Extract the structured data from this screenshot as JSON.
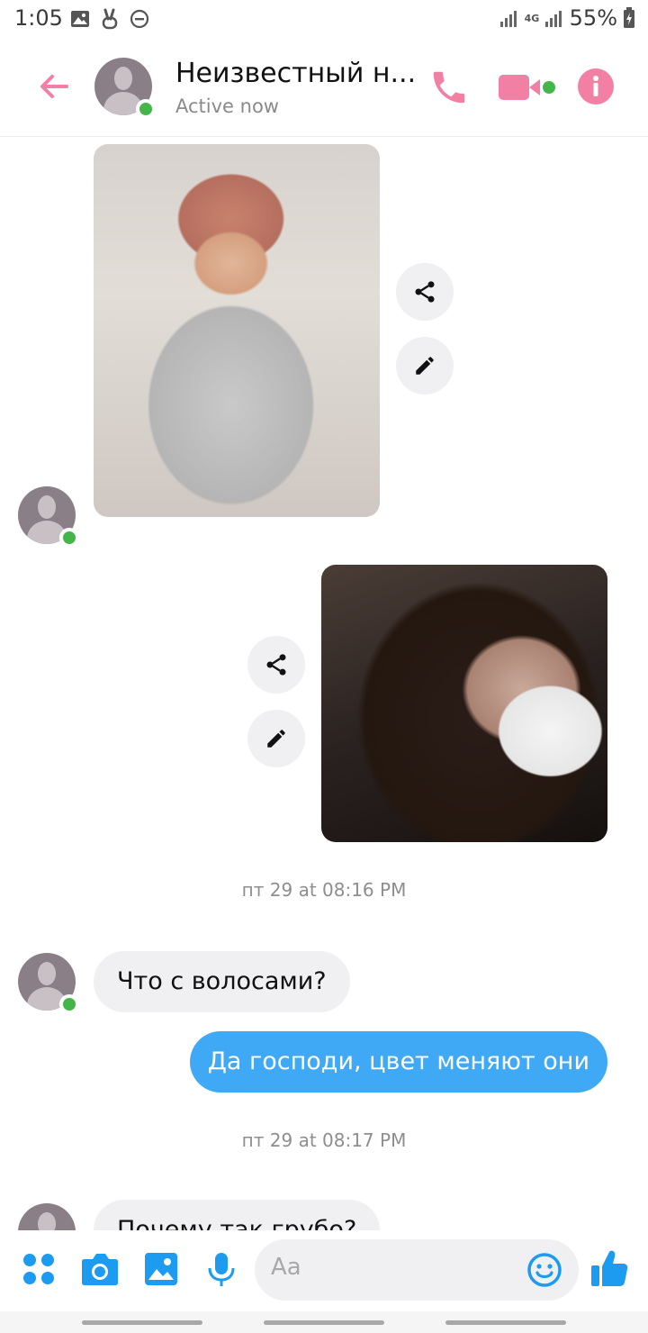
{
  "status_bar": {
    "time": "1:05",
    "network": "4G",
    "battery": "55%"
  },
  "header": {
    "title": "Неизвестный н...",
    "subtitle": "Active now"
  },
  "messages": {
    "timestamp1": "пт 29 at 08:16 PM",
    "incoming1": "Что с волосами?",
    "outgoing1": "Да господи, цвет меняют они",
    "timestamp2": "пт 29 at 08:17 PM",
    "incoming2": "Почему так грубо?"
  },
  "composer": {
    "placeholder": "Aa"
  },
  "colors": {
    "accent_pink": "#f27fa4",
    "accent_blue": "#1d9bf0",
    "online": "#44b549",
    "outgoing_bubble": "#3fa9f5"
  },
  "icons": [
    "back-arrow-icon",
    "phone-icon",
    "video-camera-icon",
    "info-icon",
    "share-icon",
    "edit-pencil-icon",
    "apps-icon",
    "camera-icon",
    "gallery-icon",
    "microphone-icon",
    "emoji-icon",
    "thumbs-up-icon"
  ]
}
